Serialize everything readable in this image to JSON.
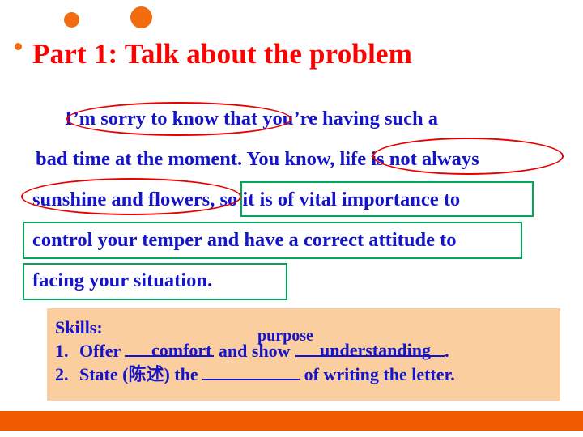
{
  "slide": {
    "title": "Part 1: Talk about the problem",
    "letter_lines": [
      "I’m sorry to know that you’re having such a",
      "bad time at the moment. You know, life is not always",
      "sunshine and flowers, so it is of vital importance to",
      "control your temper and have a correct attitude to",
      "facing your situation."
    ],
    "skills": {
      "heading": "Skills:",
      "items": [
        {
          "number": "1.",
          "text_before": "Offer",
          "blank1": "",
          "text_middle": "and show",
          "blank2": "",
          "text_after": "."
        },
        {
          "number": "2.",
          "text_before": "State (陈述) the",
          "blank1": "",
          "text_after": "of writing the letter."
        }
      ],
      "annotations": {
        "comfort": "comfort",
        "purpose": "purpose",
        "understanding": "understanding"
      }
    },
    "colors": {
      "title_red": "#FF0000",
      "body_blue": "#1414C8",
      "ellipse_red": "#E80000",
      "rect_green": "#00A65A",
      "skills_bg": "#FBCEA0",
      "accent_orange": "#F15A00"
    }
  }
}
